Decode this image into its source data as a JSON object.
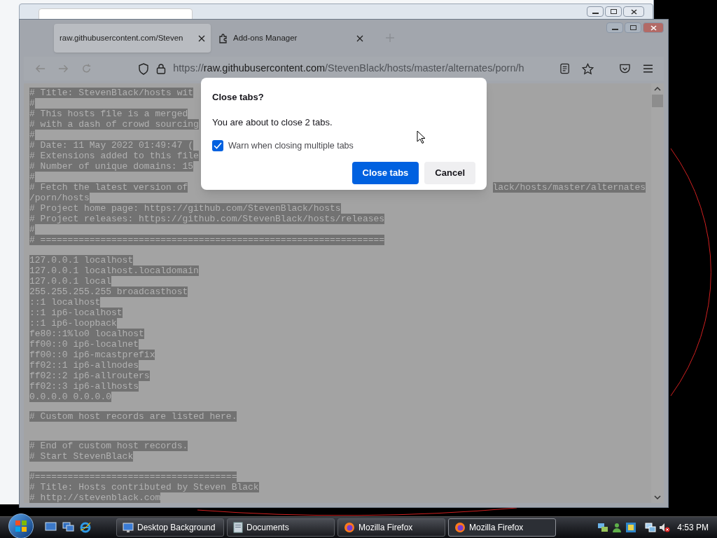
{
  "browser": {
    "tabs": [
      {
        "label": "raw.githubusercontent.com/Steven",
        "selected": true,
        "kind": "page"
      },
      {
        "label": "Add-ons Manager",
        "selected": false,
        "kind": "addons"
      }
    ],
    "url": {
      "scheme": "https://",
      "host": "raw.githubusercontent.com",
      "path": "/StevenBlack/hosts/master/alternates/porn/h"
    },
    "content_lines": [
      {
        "text": "# Title: StevenBlack/hosts wit"
      },
      {
        "text": "#"
      },
      {
        "text": "# This hosts file is a merged"
      },
      {
        "text": "# with a dash of crowd sourcing"
      },
      {
        "text": "#"
      },
      {
        "text": "# Date: 11 May 2022 01:49:47 ("
      },
      {
        "text": "# Extensions added to this file"
      },
      {
        "text": "# Number of unique domains: 15"
      },
      {
        "text": "#"
      },
      {
        "text": "# Fetch the latest version of",
        "tail": "lack/hosts/master/alternates"
      },
      {
        "text": "/porn/hosts"
      },
      {
        "text": "# Project home page: https://github.com/StevenBlack/hosts"
      },
      {
        "text": "# Project releases: https://github.com/StevenBlack/hosts/releases"
      },
      {
        "text": "#"
      },
      {
        "text": "# ==============================================================="
      },
      {
        "kind": "blank"
      },
      {
        "text": "127.0.0.1 localhost"
      },
      {
        "text": "127.0.0.1 localhost.localdomain"
      },
      {
        "text": "127.0.0.1 local"
      },
      {
        "text": "255.255.255.255 broadcasthost"
      },
      {
        "text": "::1 localhost"
      },
      {
        "text": "::1 ip6-localhost"
      },
      {
        "text": "::1 ip6-loopback"
      },
      {
        "text": "fe80::1%lo0 localhost"
      },
      {
        "text": "ff00::0 ip6-localnet"
      },
      {
        "text": "ff00::0 ip6-mcastprefix"
      },
      {
        "text": "ff02::1 ip6-allnodes"
      },
      {
        "text": "ff02::2 ip6-allrouters"
      },
      {
        "text": "ff02::3 ip6-allhosts"
      },
      {
        "text": "0.0.0.0 0.0.0.0"
      },
      {
        "kind": "blank"
      },
      {
        "text": "# Custom host records are listed here."
      },
      {
        "kind": "blank"
      },
      {
        "kind": "blank"
      },
      {
        "text": "# End of custom host records."
      },
      {
        "text": "# Start StevenBlack"
      },
      {
        "kind": "blank"
      },
      {
        "text": "#====================================="
      },
      {
        "text": "# Title: Hosts contributed by Steven Black"
      },
      {
        "text": "# http://stevenblack.com"
      }
    ]
  },
  "dialog": {
    "title": "Close tabs?",
    "message": "You are about to close 2 tabs.",
    "checkbox": {
      "label": "Warn when closing multiple tabs",
      "checked": true
    },
    "buttons": [
      {
        "label": "Close tabs",
        "kind": "primary"
      },
      {
        "label": "Cancel",
        "kind": "secondary"
      }
    ]
  },
  "taskbar": {
    "items": [
      {
        "label": "Desktop Background",
        "kind": "desktop",
        "selected": false
      },
      {
        "label": "Documents",
        "kind": "folder",
        "selected": false
      },
      {
        "label": "Mozilla Firefox",
        "kind": "firefox",
        "selected": false
      },
      {
        "label": "Mozilla Firefox",
        "kind": "firefox",
        "selected": true
      }
    ],
    "clock": "4:53 PM"
  }
}
